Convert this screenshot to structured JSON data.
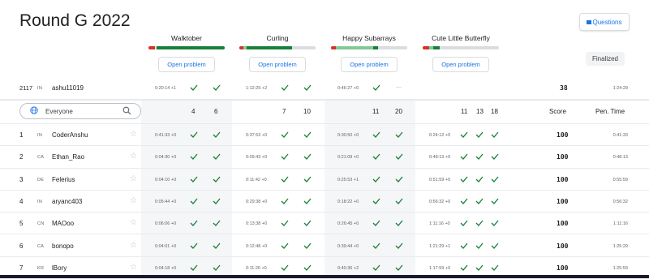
{
  "page": {
    "title": "Round G 2022"
  },
  "questions_label": "Questions",
  "finalized_label": "Finalized",
  "problems": [
    {
      "name": "Walktober",
      "open_label": "Open problem"
    },
    {
      "name": "Curling",
      "open_label": "Open problem"
    },
    {
      "name": "Happy Subarrays",
      "open_label": "Open problem"
    },
    {
      "name": "Cute Little Butterfly",
      "open_label": "Open problem"
    }
  ],
  "my_row": {
    "rank": "2117",
    "flag": "IN",
    "name": "ashu11019",
    "times": [
      "0:20:14 +1",
      "1:12:29 +2",
      "0:46:27 +0",
      "—"
    ],
    "score": "38",
    "pen_time": "1:24:29"
  },
  "filter": {
    "label": "Everyone"
  },
  "col_headers": [
    "4",
    "6",
    "7",
    "10",
    "11",
    "20",
    "11",
    "13",
    "18"
  ],
  "score_header": "Score",
  "pen_header": "Pen. Time",
  "rows": [
    {
      "rank": "1",
      "flag": "IN",
      "name": "CoderAnshu",
      "times": [
        "0:41:33 +0",
        "0:37:53 +0",
        "0:30:50 +0",
        "0:24:12 +0"
      ],
      "score": "100",
      "pen": "0:41:33"
    },
    {
      "rank": "2",
      "flag": "CA",
      "name": "Ethan_Rao",
      "times": [
        "0:04:30 +0",
        "0:09:43 +0",
        "0:21:09 +0",
        "0:48:13 +0"
      ],
      "score": "100",
      "pen": "0:48:13"
    },
    {
      "rank": "3",
      "flag": "DE",
      "name": "Felerius",
      "times": [
        "0:04:10 +0",
        "0:11:42 +0",
        "0:25:53 +1",
        "0:51:59 +0"
      ],
      "score": "100",
      "pen": "0:55:59"
    },
    {
      "rank": "4",
      "flag": "IN",
      "name": "aryanc403",
      "times": [
        "0:05:44 +0",
        "0:29:38 +0",
        "0:18:22 +0",
        "0:56:32 +0"
      ],
      "score": "100",
      "pen": "0:56:32"
    },
    {
      "rank": "5",
      "flag": "CN",
      "name": "MAOoo",
      "times": [
        "0:06:06 +0",
        "0:13:38 +0",
        "0:26:45 +0",
        "1:11:16 +0"
      ],
      "score": "100",
      "pen": "1:11:16"
    },
    {
      "rank": "6",
      "flag": "CA",
      "name": "bonopo",
      "times": [
        "0:04:01 +0",
        "0:12:48 +0",
        "0:39:44 +0",
        "1:21:29 +1"
      ],
      "score": "100",
      "pen": "1:25:29"
    },
    {
      "rank": "7",
      "flag": "KR",
      "name": "lBory",
      "times": [
        "0:04:18 +0",
        "0:11:26 +0",
        "0:40:36 +2",
        "1:17:59 +0"
      ],
      "score": "100",
      "pen": "1:25:59"
    }
  ],
  "colors": {
    "accent": "#1a73e8",
    "green": "#188038",
    "lightgreen": "#81c995",
    "red": "#d93025",
    "shade": "#f5f6f8"
  }
}
